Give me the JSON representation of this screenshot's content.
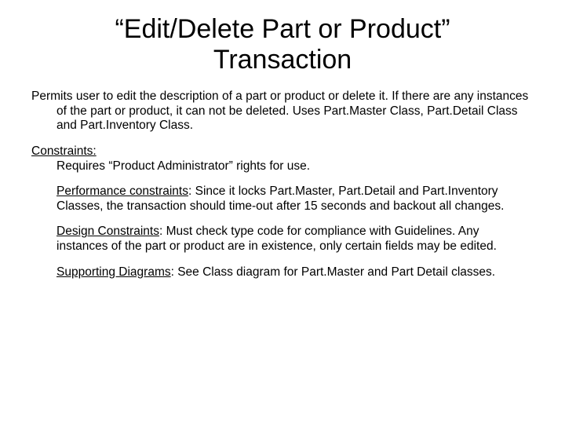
{
  "title": "“Edit/Delete Part or Product” Transaction",
  "intro": "Permits user to edit the description of a part or product or delete it.  If there are any instances of the part or product, it can not be deleted. Uses Part.Master Class, Part.Detail Class and Part.Inventory Class.",
  "constraints": {
    "heading": "Constraints:",
    "line": "Requires “Product Administrator” rights for use.",
    "performance": {
      "label": "Performance constraints",
      "text": ": Since it locks Part.Master, Part.Detail and Part.Inventory Classes, the transaction should time-out after 15 seconds and backout all changes."
    },
    "design": {
      "label": "Design Constraints",
      "text": ":  Must check type code for compliance with Guidelines.  Any instances of the part or product are in existence, only certain fields may be edited."
    },
    "supporting": {
      "label": "Supporting Diagrams",
      "text": ": See Class diagram for Part.Master and Part Detail classes."
    }
  }
}
